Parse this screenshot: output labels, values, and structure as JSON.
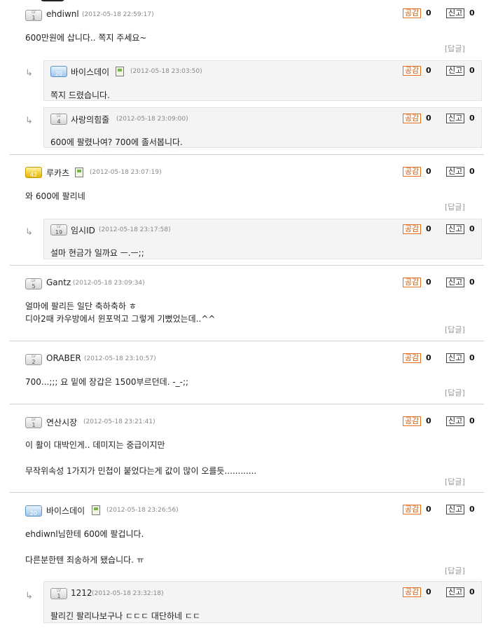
{
  "labels": {
    "like": "공감",
    "report": "신고",
    "reply": "[답글]",
    "arrow": "↳"
  },
  "comments": [
    {
      "level": "1",
      "nick": "ehdiwnl",
      "date": "(2012-05-18 22:59:17)",
      "likes": "0",
      "reports": "0",
      "lines": [
        "600만원에 삽니다.. 쪽지 주세요~"
      ]
    },
    {
      "level": "20",
      "nick": "바이스데이",
      "date": "(2012-05-18 23:03:50)",
      "likes": "0",
      "reports": "0",
      "lines": [
        "쪽지 드렸습니다."
      ]
    },
    {
      "level": "4",
      "nick": "사랑의힘줄",
      "date": "(2012-05-18 23:09:00)",
      "likes": "0",
      "reports": "0",
      "lines": [
        "600에 팔렸나여? 700에 졸서봅니다."
      ]
    },
    {
      "level": "42",
      "nick": "루카츠",
      "date": "(2012-05-18 23:07:19)",
      "likes": "0",
      "reports": "0",
      "lines": [
        "와 600에 팔리네"
      ]
    },
    {
      "level": "19",
      "nick": "임시ID",
      "date": "(2012-05-18 23:17:58)",
      "likes": "0",
      "reports": "0",
      "lines": [
        "설마 현금가 일까요 ㅡ.ㅡ;;"
      ]
    },
    {
      "level": "5",
      "nick": "Gantz",
      "date": "(2012-05-18 23:09:34)",
      "likes": "0",
      "reports": "0",
      "lines": [
        "얼마에 팔리든 일단 축하축하 ㅎ",
        "디아2때 카우방에서 윈포먹고 그렇게 기뻤었는데..^^"
      ]
    },
    {
      "level": "2",
      "nick": "ORABER",
      "date": "(2012-05-18 23:10:57)",
      "likes": "0",
      "reports": "0",
      "lines": [
        "700...;;; 요 밑에 장갑은 1500부르던데. -_-;;"
      ]
    },
    {
      "level": "1",
      "nick": "연산시장",
      "date": "(2012-05-18 23:21:41)",
      "likes": "0",
      "reports": "0",
      "lines": [
        "이 활이 대박인게.. 데미지는 중급이지만",
        "무작위속성 1가지가 민첩이 붙었다는게 값이 많이 오를듯............"
      ]
    },
    {
      "level": "20",
      "nick": "바이스데이",
      "date": "(2012-05-18 23:26:56)",
      "likes": "0",
      "reports": "0",
      "lines": [
        "ehdiwnl님한테 600에 팔겁니다.",
        "다른분한텐 죄송하게 됐습니다. ㅠ"
      ]
    },
    {
      "level": "1",
      "nick": "1212",
      "date": "(2012-05-18 23:32:18)",
      "likes": "0",
      "reports": "0",
      "lines": [
        "팔리긴 팔리나보구나 ㄷㄷㄷ 대단하네 ㄷㄷ"
      ]
    }
  ]
}
